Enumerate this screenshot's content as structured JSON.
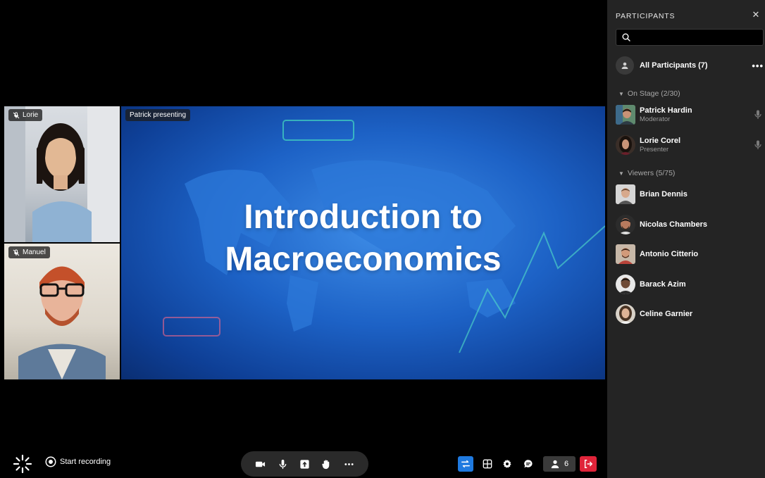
{
  "stage": {
    "tiles": [
      {
        "label": "Lorie",
        "muted": true
      },
      {
        "label": "Manuel",
        "muted": true
      }
    ],
    "presentation": {
      "label": "Patrick presenting",
      "slide_title_line1": "Introduction to",
      "slide_title_line2": "Macroeconomics"
    }
  },
  "controls": {
    "start_recording": "Start recording",
    "people_count": "6",
    "icons": [
      "camera-icon",
      "microphone-icon",
      "share-screen-icon",
      "raise-hand-icon",
      "more-icon",
      "switch-view-icon",
      "grid-icon",
      "gear-icon",
      "chat-icon",
      "people-icon",
      "leave-icon"
    ]
  },
  "sidebar": {
    "title": "PARTICIPANTS",
    "search_placeholder": "",
    "all_participants": "All Participants (7)",
    "on_stage": {
      "label": "On Stage (2/30)",
      "people": [
        {
          "name": "Patrick Hardin",
          "role": "Moderator"
        },
        {
          "name": "Lorie Corel",
          "role": "Presenter"
        }
      ]
    },
    "viewers": {
      "label": "Viewers (5/75)",
      "people": [
        {
          "name": "Brian Dennis"
        },
        {
          "name": "Nicolas Chambers"
        },
        {
          "name": "Antonio Citterio"
        },
        {
          "name": "Barack Azim"
        },
        {
          "name": "Celine Garnier"
        }
      ]
    }
  },
  "colors": {
    "accent": "#1f7ae0",
    "leave": "#e0243a",
    "sidebar_bg": "#242424"
  }
}
